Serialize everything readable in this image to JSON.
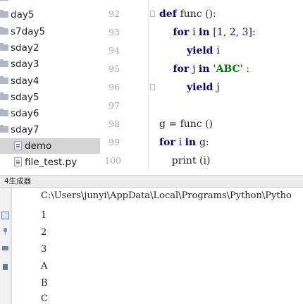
{
  "project_tree": {
    "items": [
      {
        "label": "day5",
        "type": "folder"
      },
      {
        "label": "s7day5",
        "type": "folder"
      },
      {
        "label": "sday2",
        "type": "folder"
      },
      {
        "label": "sday3",
        "type": "folder"
      },
      {
        "label": "sday4",
        "type": "folder"
      },
      {
        "label": "sday5",
        "type": "folder"
      },
      {
        "label": "sday6",
        "type": "folder"
      },
      {
        "label": "sday7",
        "type": "folder"
      },
      {
        "label": "demo",
        "type": "py",
        "selected": true
      },
      {
        "label": "file_test.py",
        "type": "py"
      }
    ]
  },
  "editor": {
    "line_numbers": [
      "92",
      "93",
      "94",
      "95",
      "96",
      "97",
      "98",
      "99",
      "100"
    ],
    "lines": [
      {
        "kw": "def ",
        "rest": "func ():"
      },
      {
        "kw": "    for ",
        "rest": "i ",
        "kw2": "in ",
        "tail": "[",
        "n1": "1",
        "c1": ", ",
        "n2": "2",
        "c2": ", ",
        "n3": "3",
        "end": "]:"
      },
      {
        "kw": "        yield ",
        "rest": "i"
      },
      {
        "kw": "    for ",
        "rest": "j ",
        "kw2": "in ",
        "str": "'ABC'",
        "end": " :"
      },
      {
        "kw": "        yield ",
        "rest": "j"
      },
      {
        "text": ""
      },
      {
        "text": "g = func ()"
      },
      {
        "kw": "for ",
        "rest": "i ",
        "kw2": "in ",
        "end": "g:"
      },
      {
        "text": "    print (i)"
      }
    ]
  },
  "run_panel": {
    "tab_label": "4生成器",
    "command": "C:\\Users\\junyi\\AppData\\Local\\Programs\\Python\\Pytho",
    "output": [
      "1",
      "2",
      "3",
      "A",
      "B",
      "C"
    ]
  },
  "colors": {
    "keyword": "#000080",
    "number": "#0000ff",
    "string": "#008000"
  }
}
